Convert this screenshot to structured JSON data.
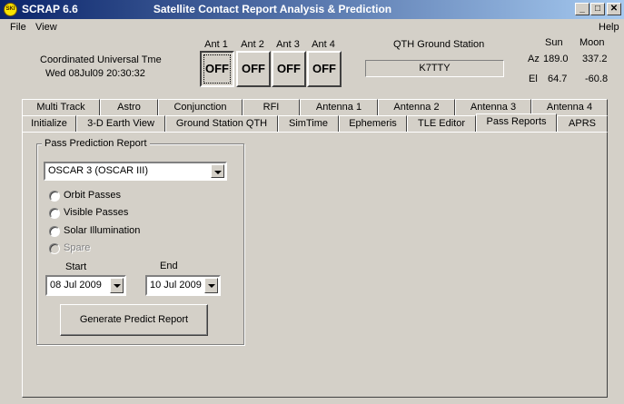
{
  "window": {
    "app_name": "SCRAP  6.6",
    "title": "Satellite Contact Report Analysis & Prediction",
    "icon_text": "SKI",
    "minimize": "_",
    "maximize": "□",
    "close": "✕"
  },
  "menu": {
    "file": "File",
    "view": "View",
    "help": "Help"
  },
  "clock": {
    "label": "Coordinated Universal Tme",
    "value": "Wed 08Jul09 20:30:32"
  },
  "antennas": [
    {
      "label": "Ant 1",
      "state": "OFF"
    },
    {
      "label": "Ant 2",
      "state": "OFF"
    },
    {
      "label": "Ant 3",
      "state": "OFF"
    },
    {
      "label": "Ant 4",
      "state": "OFF"
    }
  ],
  "qth": {
    "label": "QTH Ground Station",
    "value": "K7TTY"
  },
  "sunmoon": {
    "sun_label": "Sun",
    "moon_label": "Moon",
    "az_label": "Az",
    "el_label": "El",
    "sun_az": "189.0",
    "moon_az": "337.2",
    "sun_el": "64.7",
    "moon_el": "-60.8"
  },
  "tabs_row1": [
    "Multi Track",
    "Astro",
    "Conjunction",
    "RFI",
    "Antenna 1",
    "Antenna 2",
    "Antenna 3",
    "Antenna 4"
  ],
  "tabs_row2": [
    "Initialize",
    "3-D Earth View",
    "Ground Station QTH",
    "SimTime",
    "Ephemeris",
    "TLE Editor",
    "Pass Reports",
    "APRS"
  ],
  "active_tab": "Pass Reports",
  "report": {
    "group_title": "Pass Prediction Report",
    "satellite": "OSCAR 3 (OSCAR III)",
    "options": [
      "Orbit Passes",
      "Visible Passes",
      "Solar Illumination",
      "Spare"
    ],
    "start_label": "Start",
    "end_label": "End",
    "start_date": "08 Jul 2009",
    "end_date": "10 Jul 2009",
    "generate_label": "Generate Predict Report"
  }
}
